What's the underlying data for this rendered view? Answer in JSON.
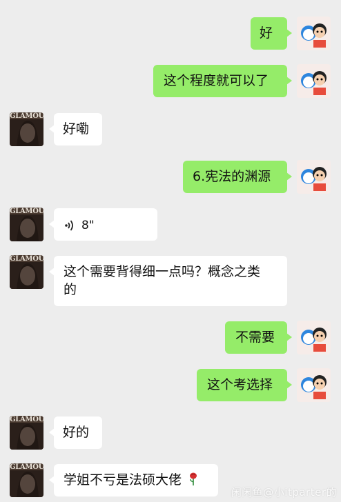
{
  "messages": [
    {
      "side": "right",
      "text": "好"
    },
    {
      "side": "right",
      "text": "这个程度就可以了"
    },
    {
      "side": "left",
      "text": "好嘞"
    },
    {
      "side": "right",
      "text": "6.宪法的渊源"
    },
    {
      "side": "left",
      "type": "voice",
      "duration": "8\""
    },
    {
      "side": "left",
      "text": "这个需要背得细一点吗？概念之类\n的"
    },
    {
      "side": "right",
      "text": "不需要"
    },
    {
      "side": "right",
      "text": "这个考选择"
    },
    {
      "side": "left",
      "text": "好的"
    },
    {
      "side": "left",
      "text": "学姐不亏是法硕大佬",
      "emoji": "rose-icon"
    }
  ],
  "avatar_left_label": "GLAMOUR",
  "watermark": "闲闲鱼@小itparter的",
  "colors": {
    "background": "#ededed",
    "bubble_right": "#95ec69",
    "bubble_left": "#ffffff"
  }
}
